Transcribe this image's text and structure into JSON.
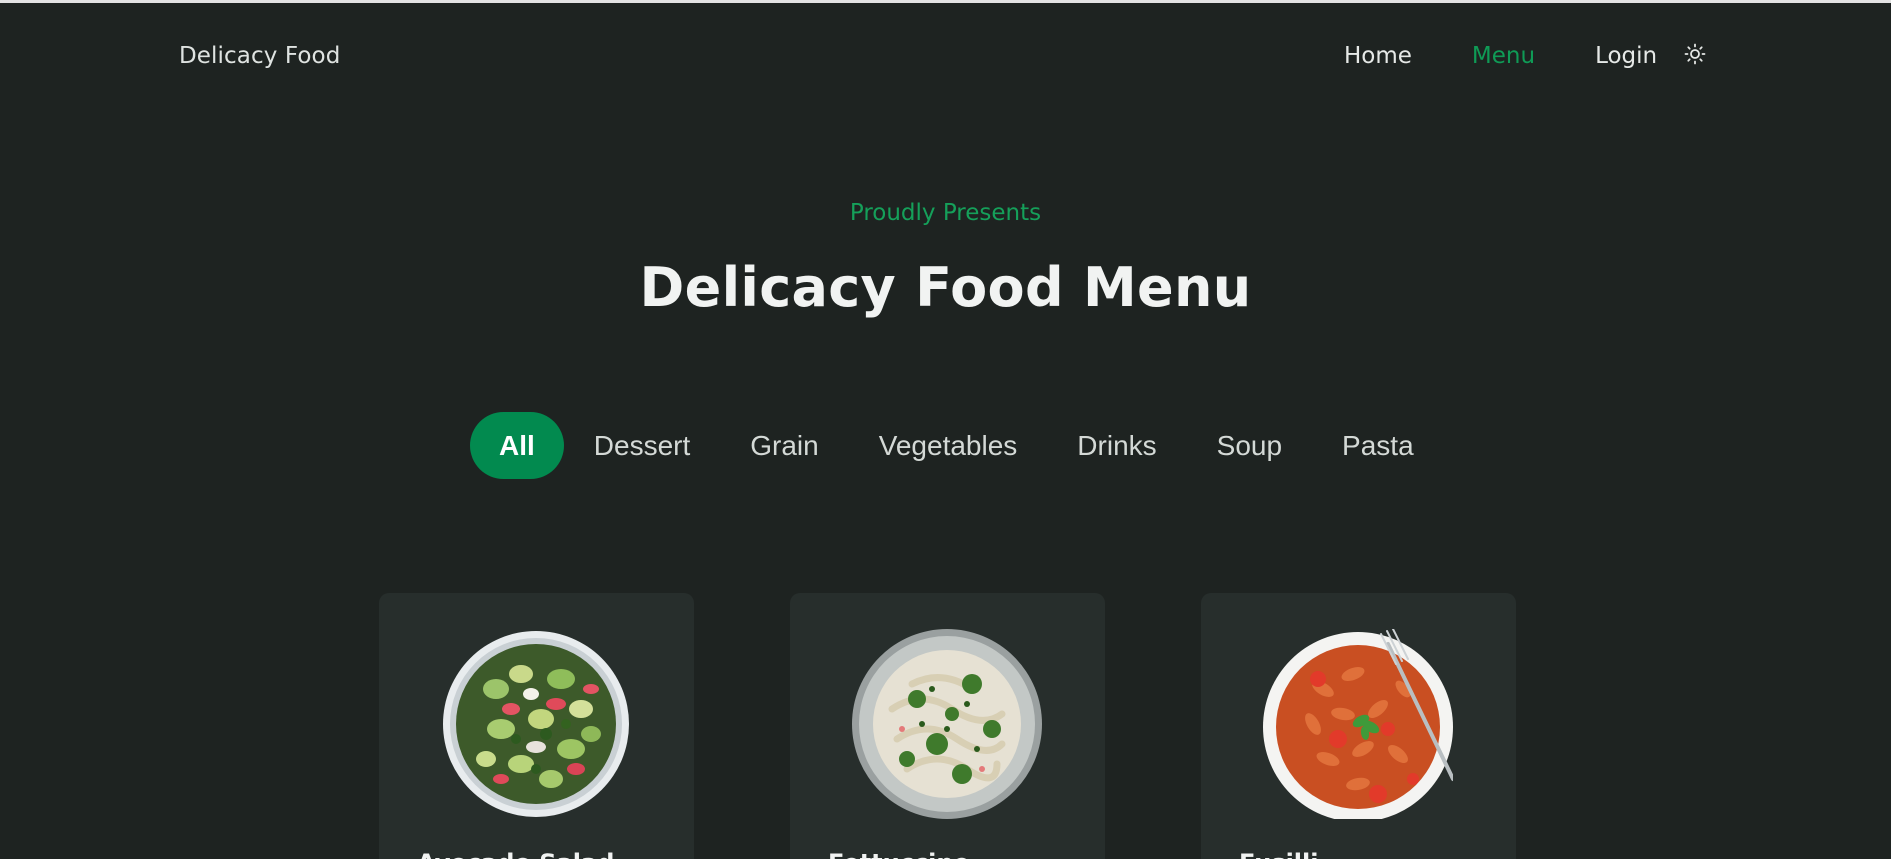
{
  "header": {
    "brand": "Delicacy Food",
    "nav": {
      "home": "Home",
      "menu": "Menu",
      "login": "Login"
    },
    "theme_icon": "sun-icon"
  },
  "hero": {
    "subtitle": "Proudly Presents",
    "title": "Delicacy Food Menu"
  },
  "filters": {
    "items": [
      "All",
      "Dessert",
      "Grain",
      "Vegetables",
      "Drinks",
      "Soup",
      "Pasta"
    ],
    "active": "All"
  },
  "cards": [
    {
      "name": "Avocado Salad",
      "image": "salad-bowl"
    },
    {
      "name": "Fettuccine",
      "image": "pasta-plate"
    },
    {
      "name": "Fusilli",
      "image": "fusilli-plate"
    }
  ],
  "colors": {
    "background": "#1e2321",
    "card": "#272e2c",
    "accent": "#028a4f",
    "accent_text": "#15a05a"
  }
}
